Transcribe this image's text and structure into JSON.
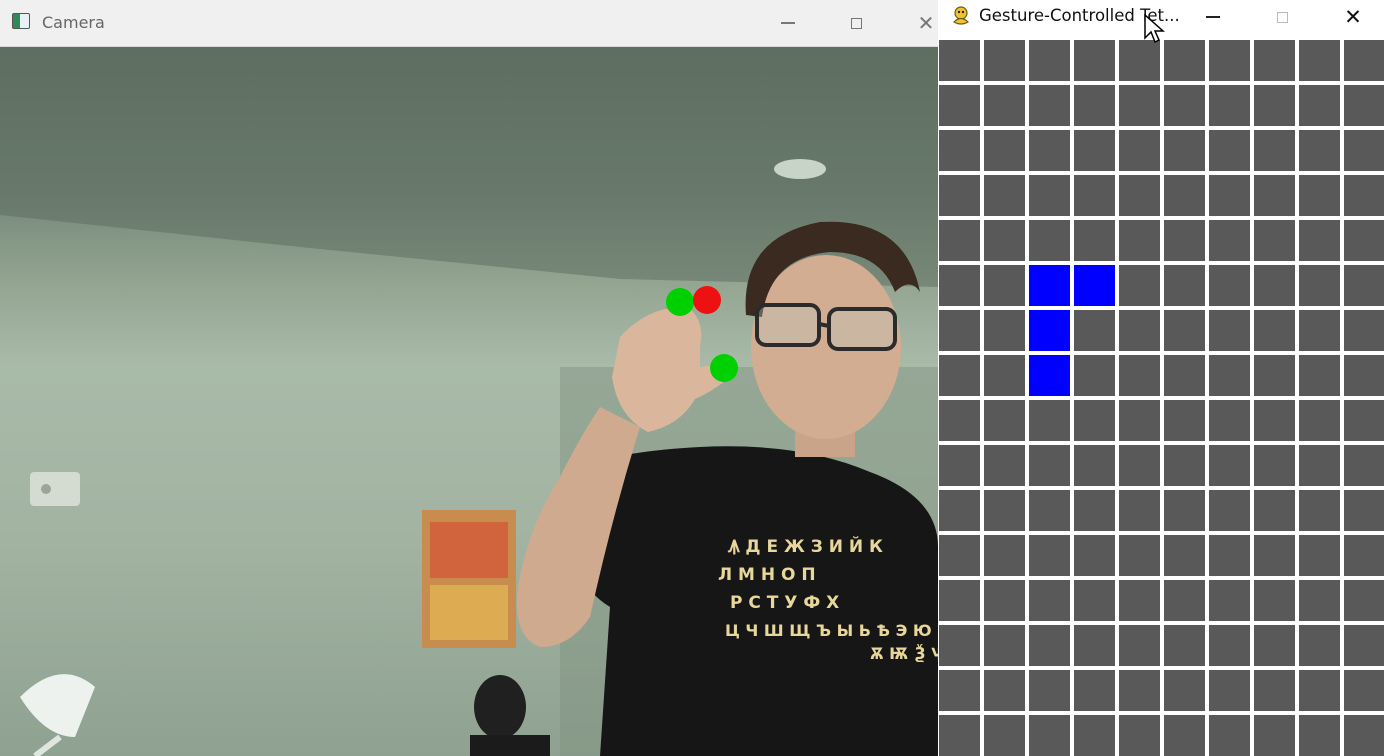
{
  "camera_window": {
    "title": "Camera",
    "icon": "camera-app-icon",
    "controls": {
      "minimize": "minimize-icon",
      "maximize": "maximize-icon",
      "close": "close-icon"
    }
  },
  "camera_feed": {
    "landmarks": [
      {
        "name": "index-fingertip-marker",
        "color": "#00d000"
      },
      {
        "name": "middle-fingertip-marker",
        "color": "#ee1111"
      },
      {
        "name": "thumb-tip-marker",
        "color": "#00d000"
      }
    ],
    "shirt_print": [
      "Ꙟ Д Е Ж З И Й К",
      "Л М Н О П",
      "Р С Т У Ф Х",
      "Ц Ч Ш Щ Ъ Ы Ь Ѣ Э Ю Я",
      "Ѫ Ѭ Ѯ Ѱ"
    ]
  },
  "game_window": {
    "title": "Gesture-Controlled Tet...",
    "icon": "pygame-snake-icon",
    "controls": {
      "minimize": "minimize-icon",
      "maximize": "maximize-icon",
      "close": "close-icon"
    }
  },
  "board": {
    "columns": 10,
    "visible_rows": 16,
    "empty_color": "#595959",
    "block_color": "#0000ff",
    "grid_line_color": "#ffffff",
    "active_piece_cells": [
      [
        5,
        2
      ],
      [
        5,
        3
      ],
      [
        6,
        2
      ],
      [
        7,
        2
      ]
    ]
  }
}
